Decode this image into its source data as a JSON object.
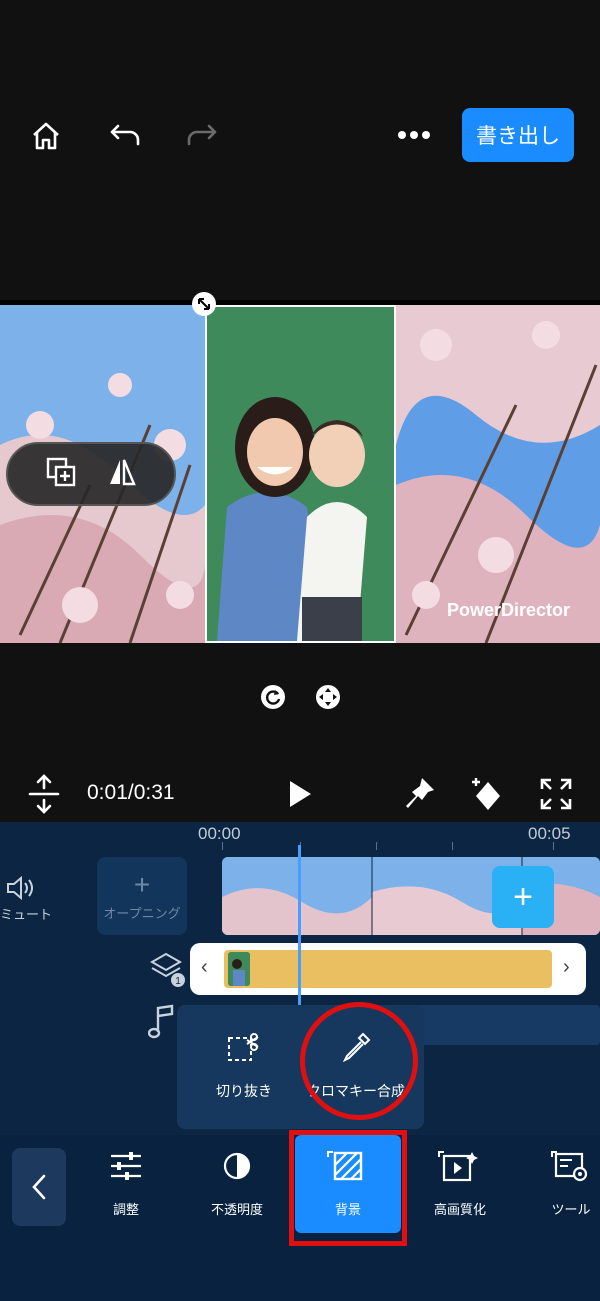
{
  "header": {
    "icons": [
      "home-icon",
      "undo-icon",
      "redo-icon",
      "more-icon"
    ],
    "export_label": "書き出し"
  },
  "preview": {
    "watermark": "PowerDirector"
  },
  "playback": {
    "time": "0:01/0:31"
  },
  "timeline": {
    "ruler": [
      "00:00",
      "00:05"
    ],
    "mute_label": "ミュート",
    "opening_label": "オープニング"
  },
  "submenu": {
    "items": [
      {
        "label": "切り抜き",
        "icon": "cutout-icon"
      },
      {
        "label": "クロマキー合成",
        "icon": "eyedropper-icon"
      }
    ]
  },
  "toolbar": {
    "items": [
      {
        "label": "調整",
        "icon": "sliders-icon"
      },
      {
        "label": "不透明度",
        "icon": "opacity-icon"
      },
      {
        "label": "背景",
        "icon": "background-icon"
      },
      {
        "label": "高画質化",
        "icon": "enhance-icon"
      },
      {
        "label": "ツール",
        "icon": "tools-icon"
      }
    ]
  },
  "colors": {
    "accent": "#1a8cff",
    "highlight": "#e01010",
    "panel": "#0c2542"
  }
}
